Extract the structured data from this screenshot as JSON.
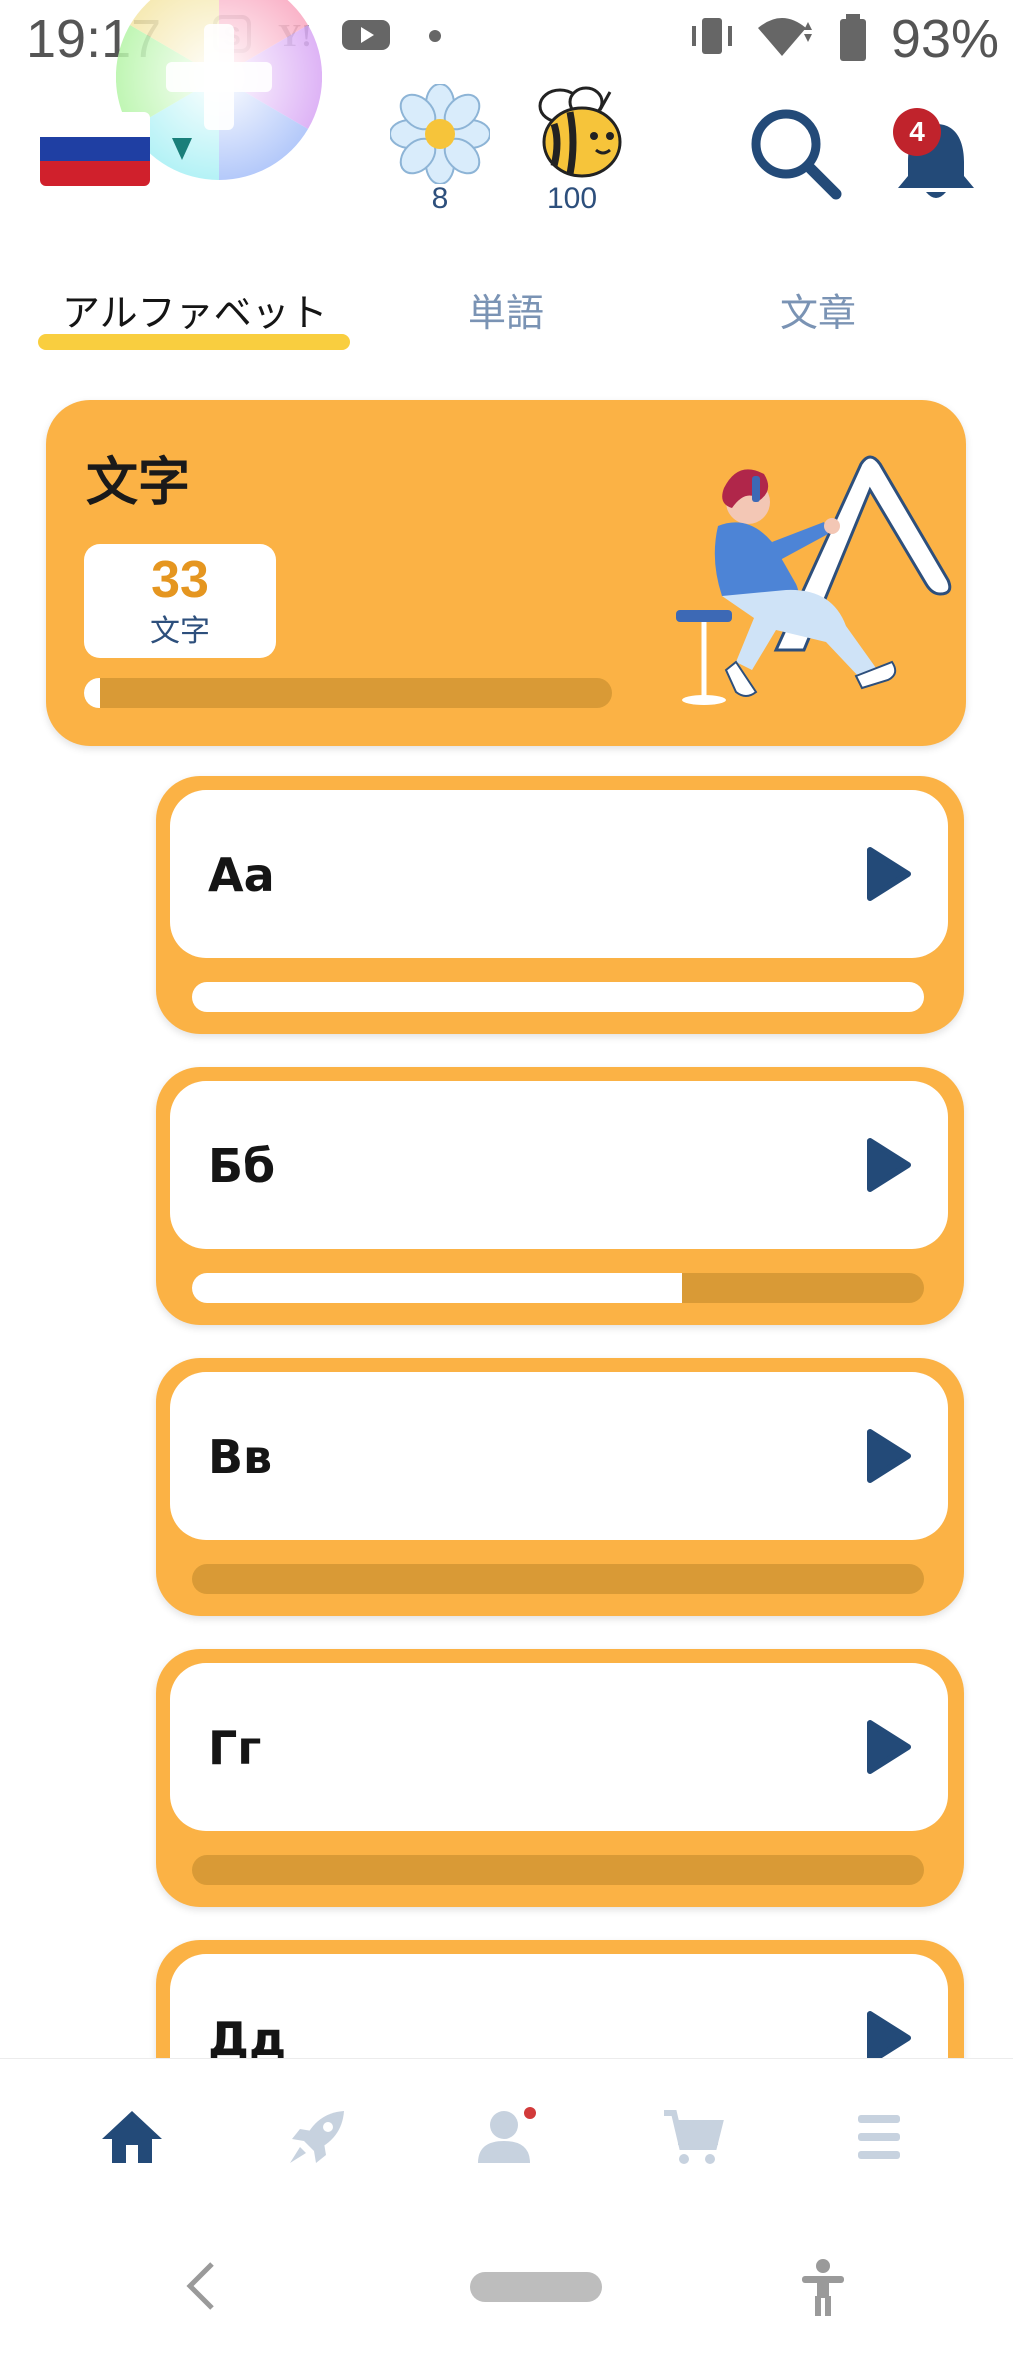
{
  "status_bar": {
    "time": "19:17",
    "battery": "93%"
  },
  "header": {
    "flowers_count": "8",
    "bee_count": "100",
    "notification_count": "4"
  },
  "tabs": [
    {
      "label": "アルファベット",
      "active": true
    },
    {
      "label": "単語",
      "active": false
    },
    {
      "label": "文章",
      "active": false
    }
  ],
  "summary": {
    "title": "文字",
    "count": "33",
    "count_unit": "文字",
    "progress": 0.03
  },
  "letters": [
    {
      "label": "Аа",
      "progress": 1.0
    },
    {
      "label": "Бб",
      "progress": 0.67
    },
    {
      "label": "Вв",
      "progress": 0.0
    },
    {
      "label": "Гг",
      "progress": 0.0
    },
    {
      "label": "Дд",
      "progress": 0.0
    }
  ],
  "colors": {
    "card_orange": "#fbb245",
    "bar_track": "#d99a36",
    "navy": "#2d4f7c",
    "badge_red": "#c0232c",
    "tab_underline": "#f9ce3f"
  },
  "bottom_nav": [
    "home-icon",
    "rocket-icon",
    "profile-icon",
    "cart-icon",
    "menu-icon"
  ]
}
